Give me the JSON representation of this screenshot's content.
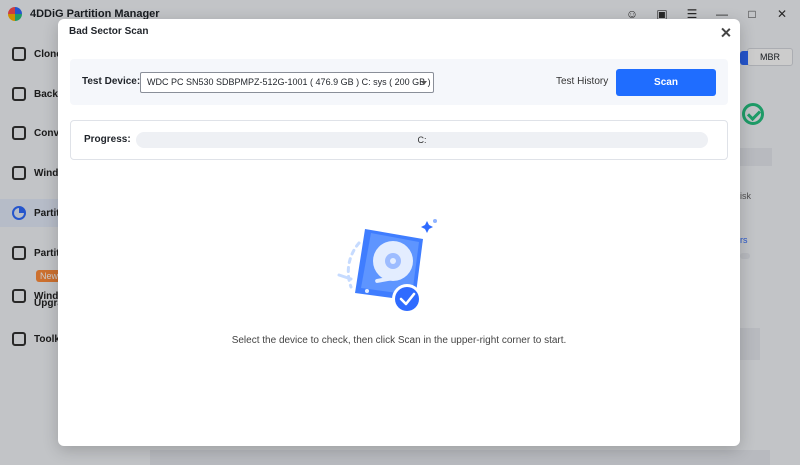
{
  "app": {
    "title": "4DDiG Partition Manager",
    "window_controls": [
      "user-icon",
      "feedback-icon",
      "menu-icon",
      "minimize-icon",
      "maximize-icon",
      "close-icon"
    ]
  },
  "sidebar": {
    "items": [
      {
        "label": "Clone",
        "icon": "clone-icon"
      },
      {
        "label": "Backu",
        "icon": "backup-icon"
      },
      {
        "label": "Conve",
        "icon": "convert-icon"
      },
      {
        "label": "Windo",
        "icon": "windows-icon"
      },
      {
        "label": "Partiti",
        "icon": "partition-icon"
      },
      {
        "label": "Partiti",
        "icon": "partition-tool-icon"
      },
      {
        "label": "Windo",
        "icon": "upgrade-icon"
      },
      {
        "label": "Toolki",
        "icon": "toolkit-icon"
      }
    ],
    "new_badge": "New",
    "upgrade_sub": "Upgra"
  },
  "right_panel": {
    "mbr_label": "MBR",
    "partial_text_1": "isk",
    "partial_text_2": "rs"
  },
  "modal": {
    "title": "Bad Sector Scan",
    "test_device_label": "Test Device:",
    "device_selected": "WDC PC SN530 SDBPMPZ-512G-1001 ( 476.9 GB )  C: sys ( 200 GB )",
    "test_history_label": "Test History",
    "scan_label": "Scan",
    "progress_label": "Progress:",
    "progress_text": "C:",
    "progress_value": 0,
    "hint": "Select the device to check, then click Scan in the upper-right corner to start."
  },
  "colors": {
    "accent": "#1f6dff",
    "success": "#26c281"
  }
}
